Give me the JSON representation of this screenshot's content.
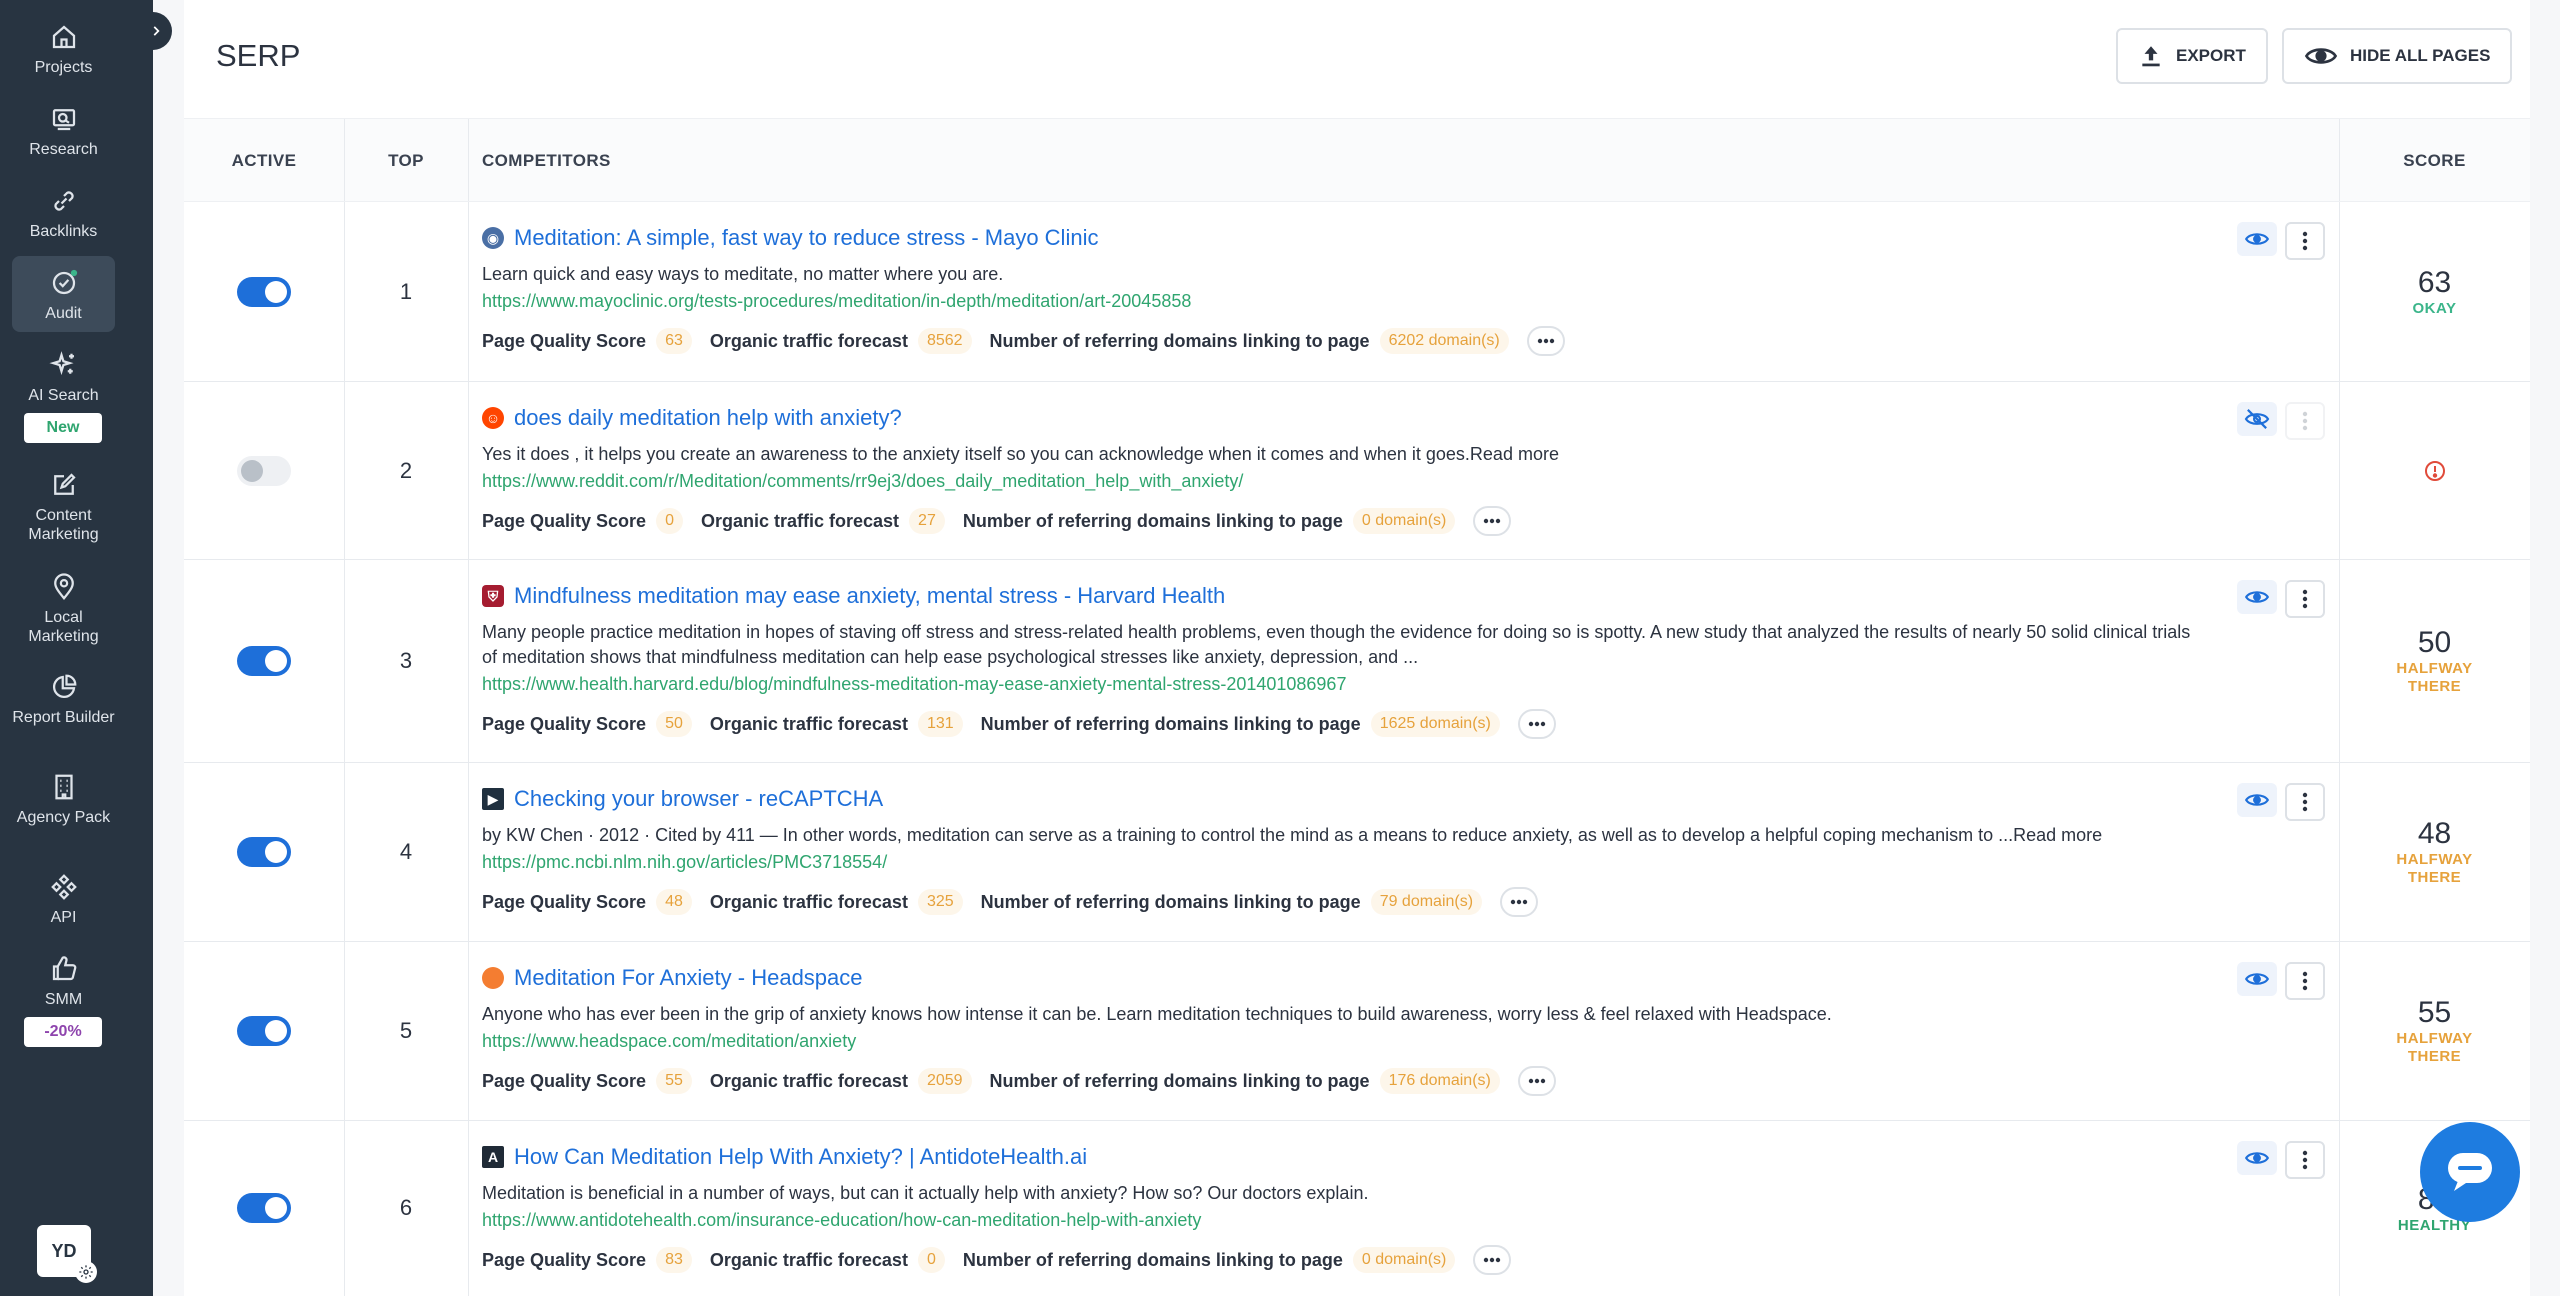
{
  "sidebar": {
    "items": [
      {
        "label": "Projects",
        "icon": "home-icon"
      },
      {
        "label": "Research",
        "icon": "research-icon"
      },
      {
        "label": "Backlinks",
        "icon": "link-icon"
      },
      {
        "label": "Audit",
        "icon": "audit-icon"
      },
      {
        "label": "AI Search",
        "icon": "sparkle-icon"
      },
      {
        "label": "Content Marketing",
        "icon": "edit-icon"
      },
      {
        "label": "Local Marketing",
        "icon": "location-pin-icon"
      },
      {
        "label": "Report Builder",
        "icon": "pie-chart-icon"
      },
      {
        "label": "Agency Pack",
        "icon": "building-icon"
      },
      {
        "label": "API",
        "icon": "api-icon"
      },
      {
        "label": "SMM",
        "icon": "thumbs-up-icon"
      }
    ],
    "ai_search_badge": "New",
    "smm_badge": "-20%",
    "avatar_initials": "YD"
  },
  "header": {
    "title": "SERP",
    "export_label": "EXPORT",
    "hide_pages_label": "HIDE ALL PAGES"
  },
  "table": {
    "columns": {
      "active": "ACTIVE",
      "top": "TOP",
      "competitors": "COMPETITORS",
      "score": "SCORE"
    },
    "metric_labels": {
      "quality": "Page Quality Score",
      "traffic": "Organic traffic forecast",
      "domains": "Number of referring domains linking to page"
    },
    "rows": [
      {
        "active": true,
        "top": "1",
        "title": "Meditation: A simple, fast way to reduce stress - Mayo Clinic",
        "desc": "Learn quick and easy ways to meditate, no matter where you are.",
        "url": "https://www.mayoclinic.org/tests-procedures/meditation/in-depth/meditation/art-20045858",
        "quality": "63",
        "traffic": "8562",
        "domains": "6202 domain(s)",
        "score": "63",
        "score_label": "OKAY",
        "visible": true
      },
      {
        "active": false,
        "top": "2",
        "title": "does daily meditation help with anxiety?",
        "desc": "Yes it does , it helps you create an awareness to the anxiety itself so you can acknowledge when it comes and when it goes.Read more",
        "url": "https://www.reddit.com/r/Meditation/comments/rr9ej3/does_daily_meditation_help_with_anxiety/",
        "quality": "0",
        "traffic": "27",
        "domains": "0 domain(s)",
        "score": "",
        "score_label": "",
        "visible": false
      },
      {
        "active": true,
        "top": "3",
        "title": "Mindfulness meditation may ease anxiety, mental stress - Harvard Health",
        "desc": "Many people practice meditation in hopes of staving off stress and stress-related health problems, even though the evidence for doing so is spotty. A new study that analyzed the results of nearly 50 solid clinical trials of meditation shows that mindfulness meditation can help ease psychological stresses like anxiety, depression, and ...",
        "url": "https://www.health.harvard.edu/blog/mindfulness-meditation-may-ease-anxiety-mental-stress-201401086967",
        "quality": "50",
        "traffic": "131",
        "domains": "1625 domain(s)",
        "score": "50",
        "score_label": "HALFWAY THERE",
        "visible": true
      },
      {
        "active": true,
        "top": "4",
        "title": "Checking your browser - reCAPTCHA",
        "desc": "by KW Chen · 2012 · Cited by 411 — In other words, meditation can serve as a training to control the mind as a means to reduce anxiety, as well as to develop a helpful coping mechanism to ...Read more",
        "url": "https://pmc.ncbi.nlm.nih.gov/articles/PMC3718554/",
        "quality": "48",
        "traffic": "325",
        "domains": "79 domain(s)",
        "score": "48",
        "score_label": "HALFWAY THERE",
        "visible": true
      },
      {
        "active": true,
        "top": "5",
        "title": "Meditation For Anxiety - Headspace",
        "desc": "Anyone who has ever been in the grip of anxiety knows how intense it can be. Learn meditation techniques to build awareness, worry less & feel relaxed with Headspace.",
        "url": "https://www.headspace.com/meditation/anxiety",
        "quality": "55",
        "traffic": "2059",
        "domains": "176 domain(s)",
        "score": "55",
        "score_label": "HALFWAY THERE",
        "visible": true
      },
      {
        "active": true,
        "top": "6",
        "title": "How Can Meditation Help With Anxiety? | AntidoteHealth.ai",
        "desc": "Meditation is beneficial in a number of ways, but can it actually help with anxiety? How so? Our doctors explain.",
        "url": "https://www.antidotehealth.com/insurance-education/how-can-meditation-help-with-anxiety",
        "quality": "83",
        "traffic": "0",
        "domains": "0 domain(s)",
        "score": "83",
        "score_label": "HEALTHY",
        "visible": true
      }
    ]
  },
  "colors": {
    "accent": "#1e6fd9",
    "url_green": "#2fa56f",
    "okay": "#3bb58a",
    "halfway": "#e6a23c",
    "healthy": "#2fa56f",
    "error": "#e04b3a",
    "sidebar_bg": "#283441"
  }
}
